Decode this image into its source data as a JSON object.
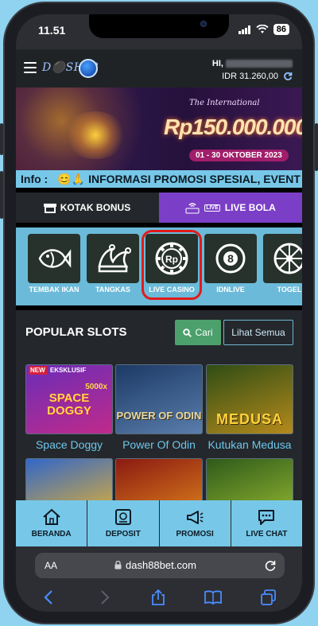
{
  "status": {
    "time": "11.51",
    "battery": "86"
  },
  "header": {
    "logo_text": "D⚫SH88",
    "greeting": "HI,",
    "balance": "IDR 31.260,00"
  },
  "banner": {
    "subtitle": "The International",
    "amount": "Rp150.000.000",
    "dates": "01 - 30 OKTOBER 2023"
  },
  "info": {
    "label": "Info :",
    "emoji": "😊🙏",
    "text": "INFORMASI PROMOSI SPESIAL, EVENT"
  },
  "tabs": [
    {
      "label": "KOTAK BONUS"
    },
    {
      "label": "LIVE BOLA",
      "badge": "LIVE"
    }
  ],
  "categories": [
    {
      "label": "TEMBAK IKAN",
      "icon": "fish-icon"
    },
    {
      "label": "TANGKAS",
      "icon": "jester-hat-icon"
    },
    {
      "label": "LIVE CASINO",
      "icon": "casino-chip-icon",
      "chip_text": "Rp",
      "active": true
    },
    {
      "label": "IDNLIVE",
      "icon": "billiard-ball-icon",
      "ball_text": "8"
    },
    {
      "label": "TOGEL",
      "icon": "wheel-icon"
    }
  ],
  "slots": {
    "title": "POPULAR SLOTS",
    "search_label": "Cari",
    "see_all_label": "Lihat Semua",
    "games": [
      {
        "name": "Space Doggy",
        "thumb": "SPACE DOGGY",
        "badge_new": "NEW",
        "badge_exclusive": "EKSKLUSIF",
        "extra": "5000x",
        "colors": [
          "#6a2db8",
          "#c02a8a"
        ]
      },
      {
        "name": "Power Of Odin",
        "thumb": "POWER OF ODIN",
        "colors": [
          "#1c3a66",
          "#5a7dab"
        ]
      },
      {
        "name": "Kutukan Medusa",
        "thumb": "MEDUSA",
        "colors": [
          "#2f4d14",
          "#b58a1c"
        ]
      },
      {
        "name": "",
        "thumb": "",
        "colors": [
          "#3166c9",
          "#f2b826"
        ]
      },
      {
        "name": "",
        "thumb": "",
        "colors": [
          "#8a1a12",
          "#e58a1c"
        ]
      },
      {
        "name": "",
        "thumb": "",
        "colors": [
          "#2f5a1a",
          "#9bbf33"
        ]
      }
    ]
  },
  "bottom_nav": [
    {
      "label": "BERANDA",
      "icon": "home-icon"
    },
    {
      "label": "DEPOSIT",
      "icon": "deposit-icon"
    },
    {
      "label": "PROMOSI",
      "icon": "megaphone-icon"
    },
    {
      "label": "LIVE CHAT",
      "icon": "chat-icon"
    }
  ],
  "browser": {
    "aa": "AA",
    "url": "dash88bet.com"
  }
}
